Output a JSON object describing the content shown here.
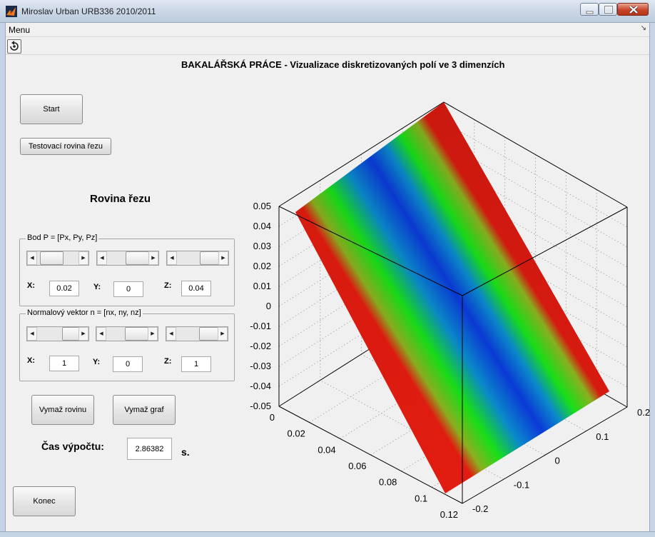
{
  "window": {
    "title": "Miroslav Urban URB336 2010/2011"
  },
  "menu": {
    "label": "Menu",
    "arrow": "↘"
  },
  "header": {
    "title": "BAKALÁŘSKÁ PRÁCE - Vizualizace diskretizovaných polí ve 3 dimenzích"
  },
  "buttons": {
    "start": "Start",
    "test_plane": "Testovací rovina řezu",
    "clear_plane": "Vymaž rovinu",
    "clear_graph": "Vymaž graf",
    "exit": "Konec"
  },
  "section": {
    "title": "Rovina řezu"
  },
  "point_panel": {
    "label": "Bod P = [Px, Py, Pz]",
    "x_label": "X:",
    "x_value": "0.02",
    "y_label": "Y:",
    "y_value": "0",
    "z_label": "Z:",
    "z_value": "0.04"
  },
  "normal_panel": {
    "label": "Normalový vektor n = [nx, ny, nz]",
    "x_label": "X:",
    "x_value": "1",
    "y_label": "Y:",
    "y_value": "0",
    "z_label": "Z:",
    "z_value": "1"
  },
  "timing": {
    "label": "Čas výpočtu:",
    "value": "2.86382",
    "unit": "s."
  },
  "chart_data": {
    "type": "surface",
    "z_ticks": [
      "0.05",
      "0.04",
      "0.03",
      "0.02",
      "0.01",
      "0",
      "-0.01",
      "-0.02",
      "-0.03",
      "-0.04",
      "-0.05"
    ],
    "x_ticks": [
      "0",
      "0.02",
      "0.04",
      "0.06",
      "0.08",
      "0.1",
      "0.12"
    ],
    "y_ticks": [
      "0.2",
      "0.1",
      "0",
      "-0.1",
      "-0.2"
    ],
    "zlim": [
      -0.05,
      0.05
    ],
    "xlim": [
      0,
      0.12
    ],
    "ylim": [
      -0.2,
      0.2
    ],
    "grid": true,
    "colors": {
      "center": "#0a3ad8",
      "mid": "#18e018",
      "edge": "#ee1a10"
    }
  }
}
